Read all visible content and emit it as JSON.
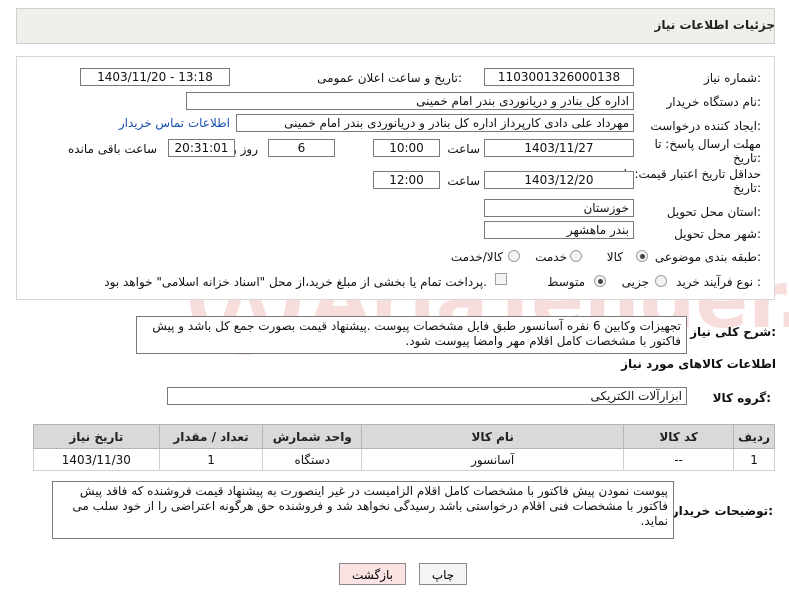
{
  "header": {
    "title": "جزئیات اطلاعات نیاز"
  },
  "fields": {
    "need_number": {
      "label": "شماره نیاز:",
      "value": "1103001326000138"
    },
    "announce": {
      "label": "تاریخ و ساعت اعلان عمومی:",
      "value": "1403/11/20 - 13:18"
    },
    "buyer_org": {
      "label": "نام دستگاه خریدار:",
      "value": "اداره کل بنادر و دریانوردی بندر امام خمینی"
    },
    "creator": {
      "label": "ایجاد کننده درخواست:",
      "value": "مهرداد علی دادی کارپرداز اداره کل بنادر و دریانوردی بندر امام خمینی",
      "contact_link": "اطلاعات تماس خریدار"
    },
    "reply_deadline": {
      "label_line1": "مهلت ارسال پاسخ: تا",
      "label_line2": "تاریخ:",
      "date": "1403/11/27",
      "time_label": "ساعت",
      "time": "10:00",
      "days": "6",
      "days_label": "روز و",
      "remaining": "20:31:01",
      "remaining_label": "ساعت باقی مانده"
    },
    "price_validity": {
      "label_line1": "حداقل تاریخ اعتبار قیمت: تا",
      "label_line2": "تاریخ:",
      "date": "1403/12/20",
      "time_label": "ساعت",
      "time": "12:00"
    },
    "province": {
      "label": "استان محل تحویل:",
      "value": "خوزستان"
    },
    "city": {
      "label": "شهر محل تحویل:",
      "value": "بندر ماهشهر"
    },
    "category": {
      "label": "طبقه بندی موضوعی:",
      "options": [
        "کالا",
        "خدمت",
        "کالا/خدمت"
      ],
      "selected": "کالا"
    },
    "purchase_type": {
      "label": "نوع فرآیند خرید :",
      "options": [
        "جزیی",
        "متوسط"
      ],
      "selected": "متوسط",
      "payment_note": "پرداخت تمام یا بخشی از مبلغ خرید،از محل \"اسناد خزانه اسلامی\" خواهد بود."
    }
  },
  "description": {
    "label": "شرح کلی نیاز:",
    "text": "تجهیزات وکابین 6 نفره آسانسور طبق فایل مشخصات پیوست .پیشنهاد قیمت بصورت جمع کل  باشد و پیش فاکتور با مشخصات کامل اقلام مهر وامضا پیوست شود."
  },
  "goods_section": {
    "title": "اطلاعات کالاهای مورد نیاز",
    "group_label": "گروه کالا:",
    "group_value": "ابزارآلات الکتریکی"
  },
  "table": {
    "headers": [
      "ردیف",
      "کد کالا",
      "نام کالا",
      "واحد شمارش",
      "تعداد / مقدار",
      "تاریخ نیاز"
    ],
    "rows": [
      [
        "1",
        "--",
        "آسانسور",
        "دستگاه",
        "1",
        "1403/11/30"
      ]
    ]
  },
  "buyer_notes": {
    "label": "توضیحات خریدار:",
    "text": "پیوست نمودن پیش فاکتور با مشخصات کامل اقلام الزامیست در غیر اینصورت به پیشنهاد قیمت فروشنده که فاقد پیش فاکتور با مشخصات فنی اقلام درخواستی باشد رسیدگی نخواهد شد و فروشنده حق هرگونه اعتراضی را از خود سلب می نماید."
  },
  "buttons": {
    "print": "چاپ",
    "back": "بازگشت"
  },
  "watermark": {
    "text": "AriaTender.neT"
  },
  "colors": {
    "link": "#1a4fb0",
    "back_button_bg": "#fbe3e3",
    "header_bg": "#f0efea"
  }
}
